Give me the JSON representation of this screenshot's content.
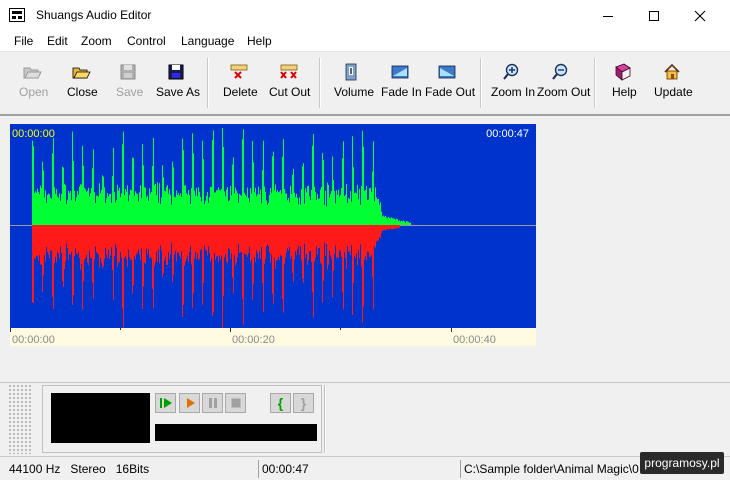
{
  "window": {
    "title": "Shuangs Audio Editor"
  },
  "menu": [
    "File",
    "Edit",
    "Zoom",
    "Control",
    "Language",
    "Help"
  ],
  "toolbar": {
    "open": "Open",
    "close": "Close",
    "save": "Save",
    "save_as": "Save As",
    "delete": "Delete",
    "cut_out": "Cut Out",
    "volume": "Volume",
    "fade_in": "Fade In",
    "fade_out": "Fade Out",
    "zoom_in": "Zoom In",
    "zoom_out": "Zoom Out",
    "help": "Help",
    "update": "Update"
  },
  "waveform": {
    "start_time": "00:00:00",
    "end_time": "00:00:47",
    "colors": {
      "background": "#0033cc",
      "upper": "#00ff33",
      "lower": "#ff1a1a",
      "centerline": "#999999"
    }
  },
  "timeline": {
    "labels": [
      "00:00:00",
      "00:00:20",
      "00:00:40"
    ]
  },
  "player": {
    "buttons": [
      "play-selection-icon",
      "play-icon",
      "pause-icon",
      "stop-icon",
      "mark-start-icon",
      "mark-end-icon"
    ],
    "mark_start": "{",
    "mark_end": "}"
  },
  "status": {
    "format": "44100 Hz   Stereo   16Bits",
    "duration": "00:00:47",
    "file": "C:\\Sample folder\\Animal Magic\\0",
    "watermark": "programosy.pl"
  }
}
